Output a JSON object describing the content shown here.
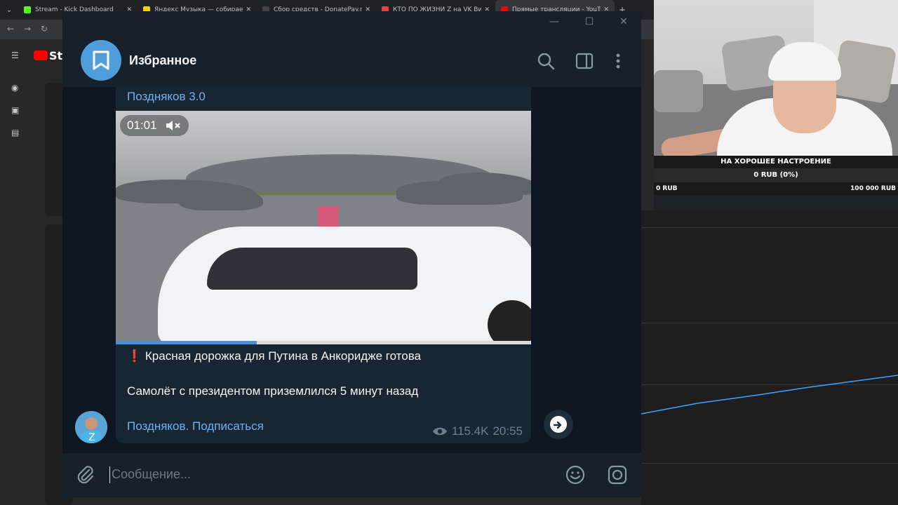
{
  "browser": {
    "tabs": [
      {
        "label": "Stream - Kick Dashboard",
        "favicon_color": "#53fc18"
      },
      {
        "label": "Яндекс Музыка — собираем",
        "favicon_color": "#ffcc00"
      },
      {
        "label": "Сбор средств - DonatePay.ru",
        "favicon_color": "#2b2b2b"
      },
      {
        "label": "КТО ПО ЖИЗНИ Z на VK Виде",
        "favicon_color": "#e24444"
      },
      {
        "label": "Прямые трансляции - YouTube",
        "favicon_color": "#ff0000"
      }
    ],
    "new_tab": "+"
  },
  "youtube": {
    "logo_text": "Stu"
  },
  "stream_goal": {
    "title": "НА ХОРОШЕЕ НАСТРОЕНИЕ",
    "current": "0 RUB (0%)",
    "min": "0 RUB",
    "max": "100 000 RUB",
    "progress_fraction": 0
  },
  "telegram": {
    "chat_title": "Избранное",
    "message": {
      "author": "Поздняков 3.0",
      "video_time": "01:01",
      "video_progress_fraction": 0.34,
      "line1_emoji": "❗",
      "line1": "Красная дорожка для Путина в Анкоридже готова",
      "line2": "Самолёт с президентом приземлился 5 минут назад",
      "link": "Поздняков. Подписаться",
      "views": "115.4K",
      "time": "20:55"
    },
    "input_placeholder": "Сообщение...",
    "colors": {
      "accent": "#6ab3f3",
      "bg": "#0e1621",
      "panel": "#17212b",
      "bubble": "#182533"
    }
  }
}
